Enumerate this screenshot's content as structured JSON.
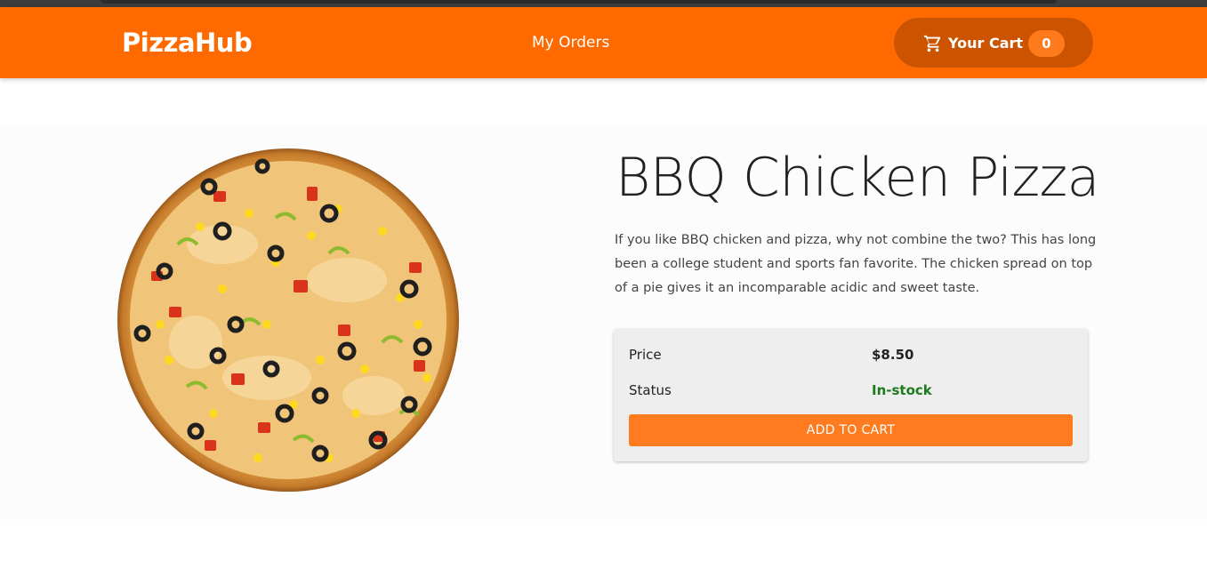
{
  "header": {
    "brand": "PizzaHub",
    "nav_orders": "My Orders",
    "cart_label": "Your Cart",
    "cart_count": "0",
    "cart_icon": "shopping-cart-icon"
  },
  "product": {
    "title": "BBQ Chicken Pizza",
    "description": "If you like BBQ chicken and pizza, why not combine the two? This has long been a college student and sports fan favorite. The chicken spread on top of a pie gives it an incomparable acidic and sweet taste.",
    "price_label": "Price",
    "price_value": "$8.50",
    "status_label": "Status",
    "status_value": "In-stock",
    "add_button": "ADD TO CART"
  },
  "colors": {
    "brand_orange": "#ff6a00",
    "cart_pill": "#cc5400",
    "button_orange": "#ff7b1f",
    "status_green": "#1e7a1e"
  }
}
